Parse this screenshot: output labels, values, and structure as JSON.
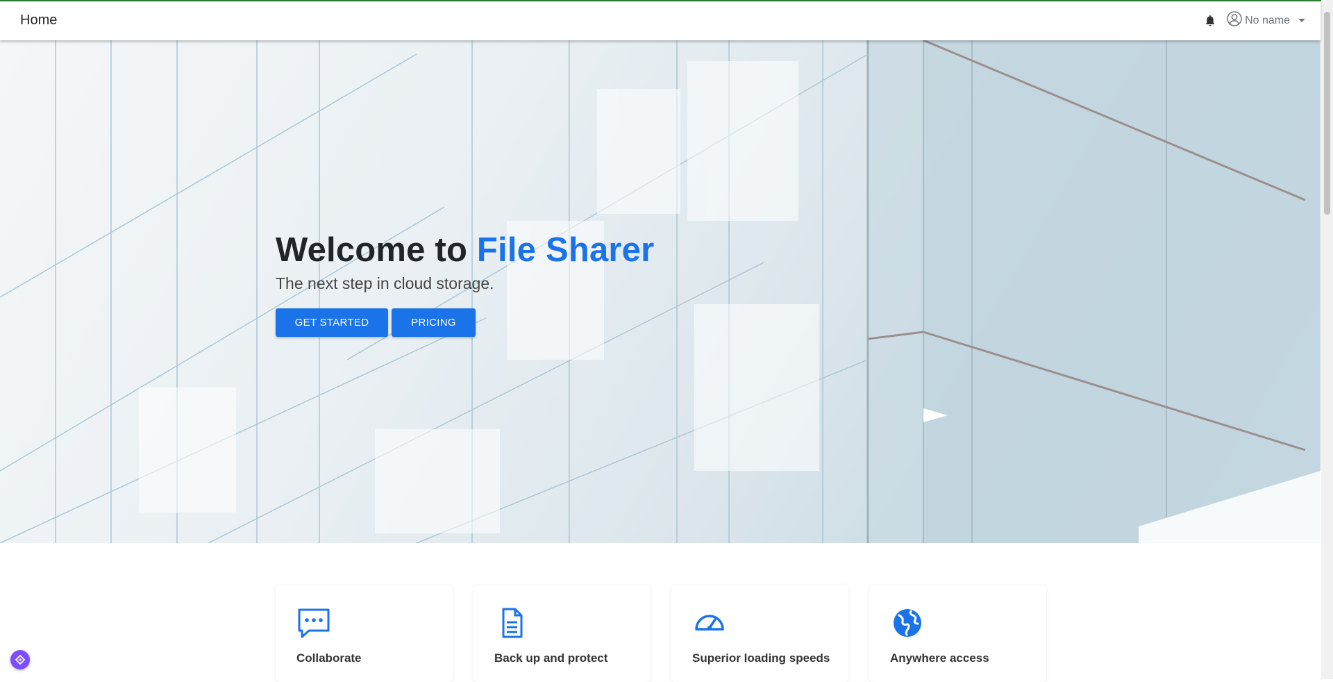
{
  "navbar": {
    "brand": "Home",
    "bell_icon": "bell-icon",
    "user_icon": "user-icon",
    "user_name": "No name"
  },
  "hero": {
    "title_prefix": "Welcome to ",
    "title_accent": "File Sharer",
    "subtitle": "The next step in cloud storage.",
    "get_started_label": "GET STARTED",
    "pricing_label": "PRICING"
  },
  "features": [
    {
      "icon": "chat-icon",
      "title": "Collaborate"
    },
    {
      "icon": "document-icon",
      "title": "Back up and protect"
    },
    {
      "icon": "speedometer-icon",
      "title": "Superior loading speeds"
    },
    {
      "icon": "globe-icon",
      "title": "Anywhere access"
    }
  ],
  "colors": {
    "accent": "#1a73e8",
    "floater": "#7c4dff"
  }
}
